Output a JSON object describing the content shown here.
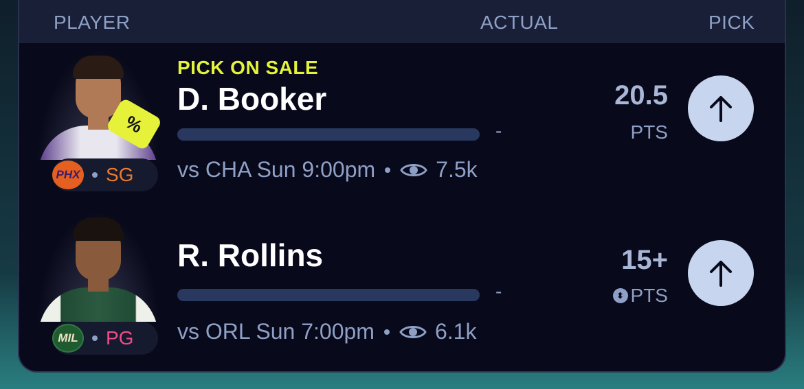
{
  "header": {
    "player": "PLAYER",
    "actual": "ACTUAL",
    "pick": "PICK"
  },
  "rows": [
    {
      "sale_label": "PICK ON SALE",
      "name": "D. Booker",
      "team": "PHX",
      "position": "SG",
      "actual": "-",
      "matchup": "vs CHA Sun 9:00pm",
      "views": "7.5k",
      "line": "20.5",
      "stat": "PTS",
      "sale_tag_text": "%",
      "colors": {
        "team": "#e56020",
        "position": "#ef7a28"
      }
    },
    {
      "name": "R. Rollins",
      "team": "MIL",
      "position": "PG",
      "actual": "-",
      "matchup": "vs ORL Sun 7:00pm",
      "views": "6.1k",
      "line": "15+",
      "stat": "PTS",
      "colors": {
        "team": "#1f5b2f",
        "position": "#f24d8a"
      }
    }
  ],
  "icons": {
    "views": "eye-icon",
    "pick": "arrow-up-icon",
    "sale": "price-tag-icon",
    "stat_toggle": "swap-icon"
  },
  "colors": {
    "background": "#08091a",
    "header": "#1a1f38",
    "accent_sale": "#e4f43a",
    "button": "#c7d5ee",
    "muted": "#8fa0c6"
  }
}
